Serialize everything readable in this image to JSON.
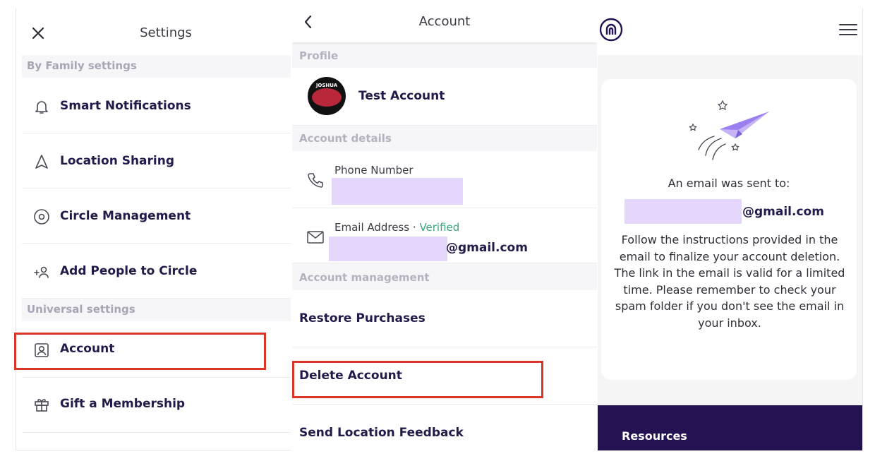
{
  "settings": {
    "title": "Settings",
    "family_section": "By Family settings",
    "family_items": [
      {
        "label": "Smart Notifications",
        "icon": "bell-icon"
      },
      {
        "label": "Location Sharing",
        "icon": "location-arrow-icon"
      },
      {
        "label": "Circle Management",
        "icon": "circle-target-icon"
      },
      {
        "label": "Add People to Circle",
        "icon": "add-person-icon"
      }
    ],
    "universal_section": "Universal settings",
    "universal_items": [
      {
        "label": "Account",
        "icon": "account-icon",
        "highlighted": true
      },
      {
        "label": "Gift a Membership",
        "icon": "gift-icon"
      }
    ]
  },
  "account": {
    "title": "Account",
    "profile_section": "Profile",
    "profile_name": "Test Account",
    "avatar_text": "JOSHUA",
    "details_section": "Account details",
    "phone_label": "Phone Number",
    "email_label": "Email Address · ",
    "email_status": "Verified",
    "email_domain": "@gmail.com",
    "management_section": "Account management",
    "management_items": [
      {
        "label": "Restore Purchases"
      },
      {
        "label": "Delete Account",
        "highlighted": true
      },
      {
        "label": "Send Location Feedback"
      }
    ]
  },
  "email_sent": {
    "heading": "An email was sent to:",
    "email_domain": "@gmail.com",
    "instructions": "Follow the instructions provided in the email to finalize your account deletion. The link in the email is valid for a limited time. Please remember to check your spam folder if you don't see the email in your inbox.",
    "resources_label": "Resources"
  },
  "colors": {
    "highlight": "#d93528",
    "redaction": "#e4d7fb",
    "brand_dark": "#241252",
    "verified": "#3aa57a",
    "accent_purple": "#9b7ff0"
  }
}
